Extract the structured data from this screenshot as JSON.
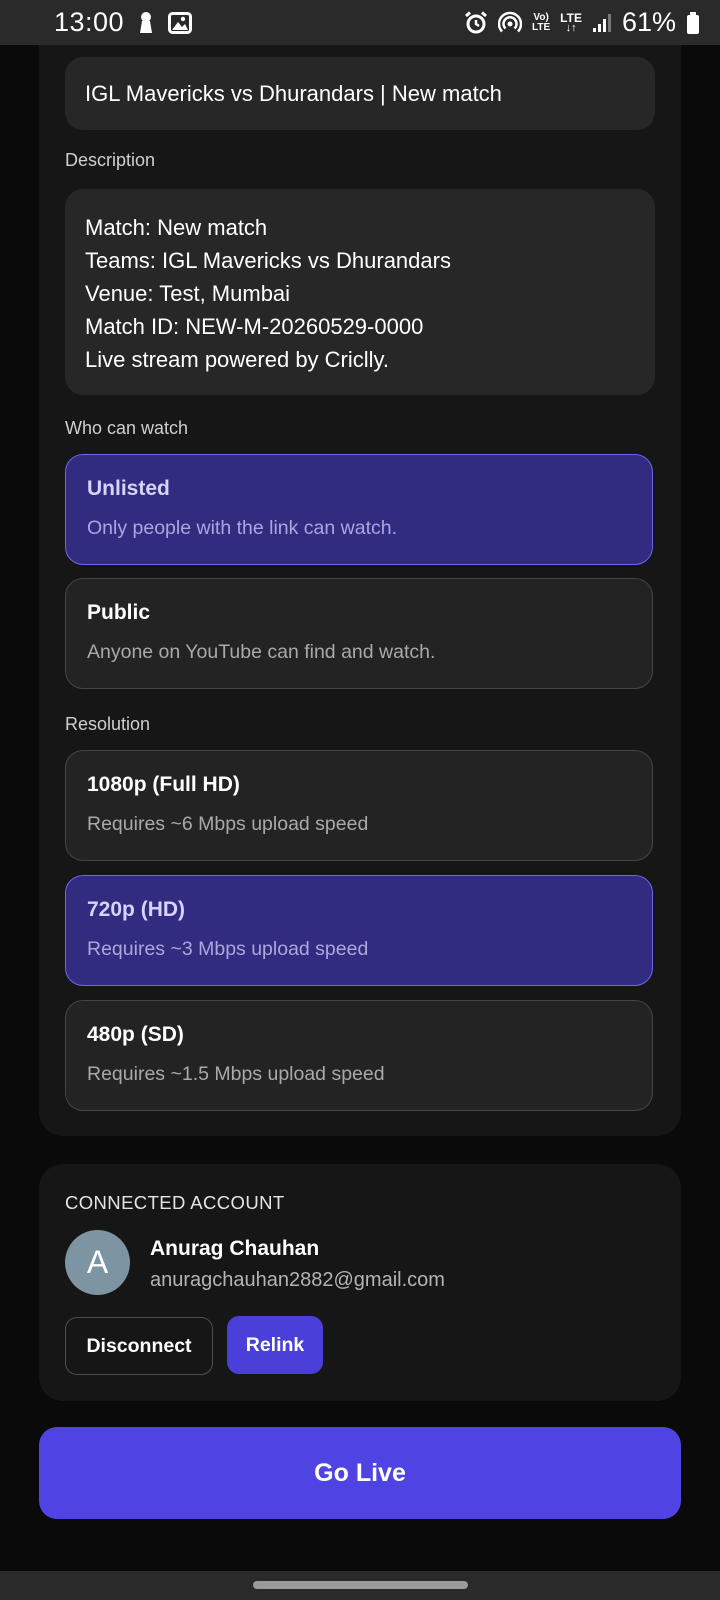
{
  "status_bar": {
    "time": "13:00",
    "battery_percent": "61%",
    "volte_label_top": "Vo)",
    "volte_label_bottom": "LTE",
    "lte_label": "LTE",
    "icons": [
      "keyhole-icon",
      "image-icon",
      "alarm-icon",
      "hotspot-icon",
      "volte-icon",
      "lte-data-icon",
      "signal-icon",
      "battery-icon"
    ]
  },
  "form": {
    "title_value": "IGL Mavericks vs Dhurandars | New match",
    "description_label": "Description",
    "description_lines": [
      "Match: New match",
      "Teams: IGL Mavericks vs Dhurandars",
      "Venue: Test, Mumbai",
      "Match ID: NEW-M-20260529-0000",
      "Live stream powered by Criclly."
    ],
    "visibility_label": "Who can watch",
    "visibility_options": [
      {
        "title": "Unlisted",
        "subtitle": "Only people with the link can watch.",
        "selected": true
      },
      {
        "title": "Public",
        "subtitle": "Anyone on YouTube can find and watch.",
        "selected": false
      }
    ],
    "resolution_label": "Resolution",
    "resolution_options": [
      {
        "title": "1080p (Full HD)",
        "subtitle": "Requires ~6 Mbps upload speed",
        "selected": false
      },
      {
        "title": "720p (HD)",
        "subtitle": "Requires ~3 Mbps upload speed",
        "selected": true
      },
      {
        "title": "480p (SD)",
        "subtitle": "Requires ~1.5 Mbps upload speed",
        "selected": false
      }
    ]
  },
  "account": {
    "section_label": "CONNECTED ACCOUNT",
    "avatar_initial": "A",
    "name": "Anurag Chauhan",
    "email": "anuragchauhan2882@gmail.com",
    "disconnect_label": "Disconnect",
    "relink_label": "Relink"
  },
  "go_live_label": "Go Live",
  "colors": {
    "accent": "#5043e3",
    "selected_bg": "#312c80",
    "selected_border": "#6d63ee",
    "card_bg": "#161616",
    "field_bg": "#272727"
  }
}
